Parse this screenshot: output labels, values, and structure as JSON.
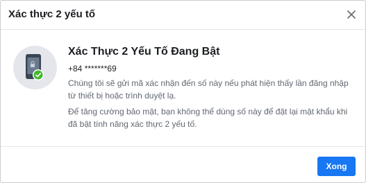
{
  "dialog": {
    "title": "Xác thực 2 yếu tố",
    "close_icon": "close-icon"
  },
  "status": {
    "icon": "phone-check-icon",
    "heading": "Xác Thực 2 Yếu Tố Đang Bật",
    "phone": "+84 *******69",
    "paragraph1": "Chúng tôi sẽ gửi mã xác nhận đến số này nếu phát hiện thấy lần đăng nhập từ thiết bị hoặc trình duyệt lạ.",
    "paragraph2": "Để tăng cường bảo mật, bạn không thể dùng số này để đặt lại mật khẩu khi đã bật tính năng xác thực 2 yếu tố."
  },
  "footer": {
    "done_label": "Xong"
  },
  "colors": {
    "primary": "#1877f2",
    "success": "#42b72a",
    "phone_body": "#3a4554"
  }
}
